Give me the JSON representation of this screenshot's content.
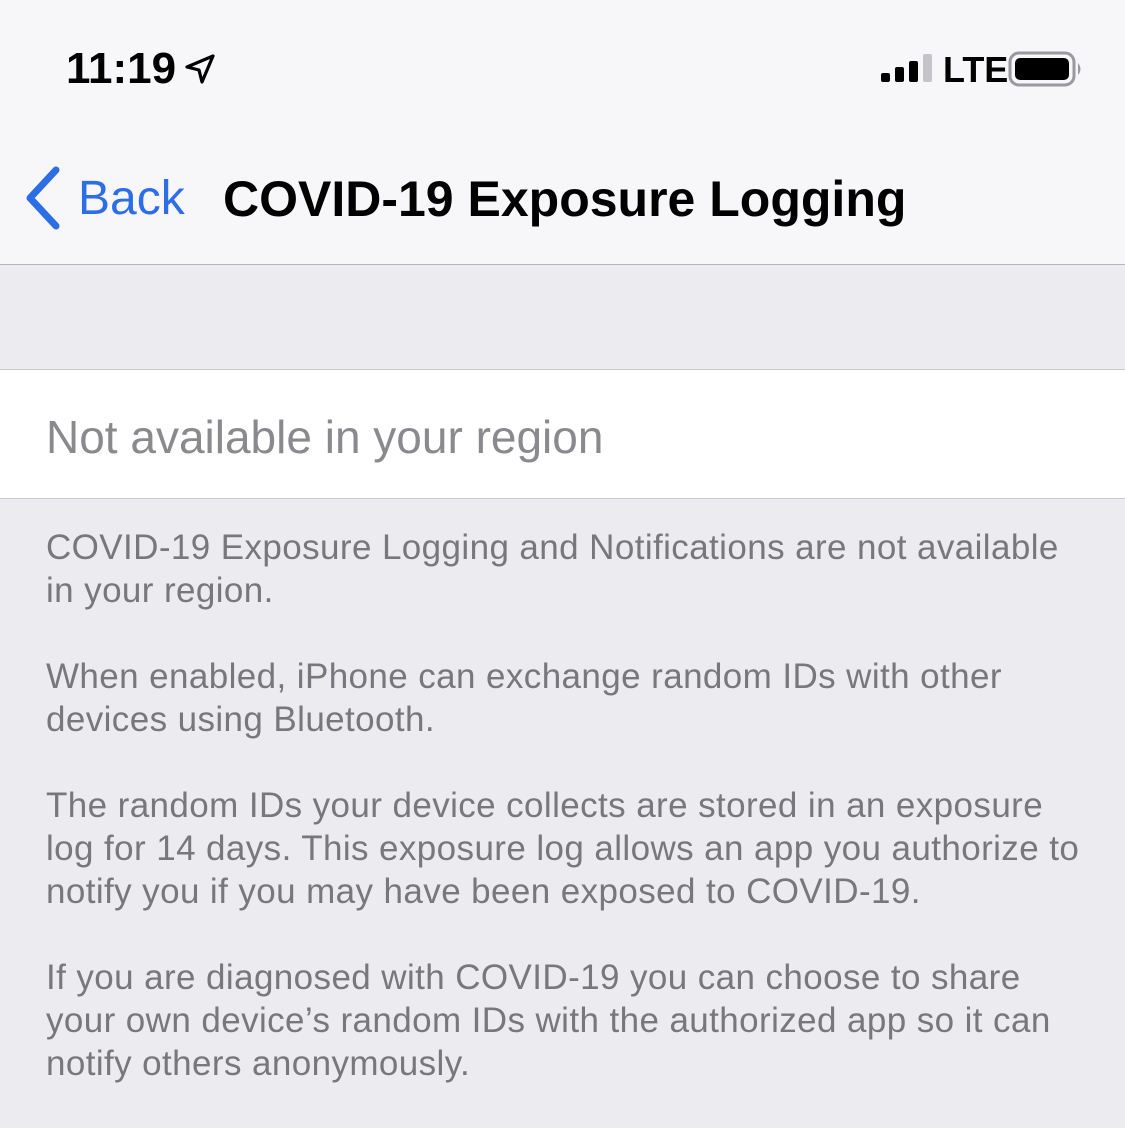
{
  "status_bar": {
    "time": "11:19",
    "network": "LTE",
    "icons": {
      "location": "location-arrow-icon",
      "signal": "cellular-signal-icon",
      "battery": "battery-icon"
    },
    "signal_bars": 3,
    "signal_bars_total": 4
  },
  "nav": {
    "back_label": "Back",
    "title": "COVID-19 Exposure Logging",
    "back_icon": "chevron-left-icon"
  },
  "status_cell": {
    "label": "Not available in your region"
  },
  "footer": {
    "paragraphs": [
      "COVID-19 Exposure Logging and Notifications are not available in your region.",
      "When enabled, iPhone can exchange random IDs with other devices using Bluetooth.",
      "The random IDs your device collects are stored in an exposure log for 14 days. This exposure log allows an app you authorize to notify you if you may have been exposed to COVID-19.",
      "If you are diagnosed with COVID-19 you can choose to share your own device’s random IDs with the authorized app so it can notify others anonymously."
    ]
  },
  "colors": {
    "accent": "#2d6ee6",
    "background": "#ebebf0",
    "secondary_text": "#8a8a8e"
  }
}
